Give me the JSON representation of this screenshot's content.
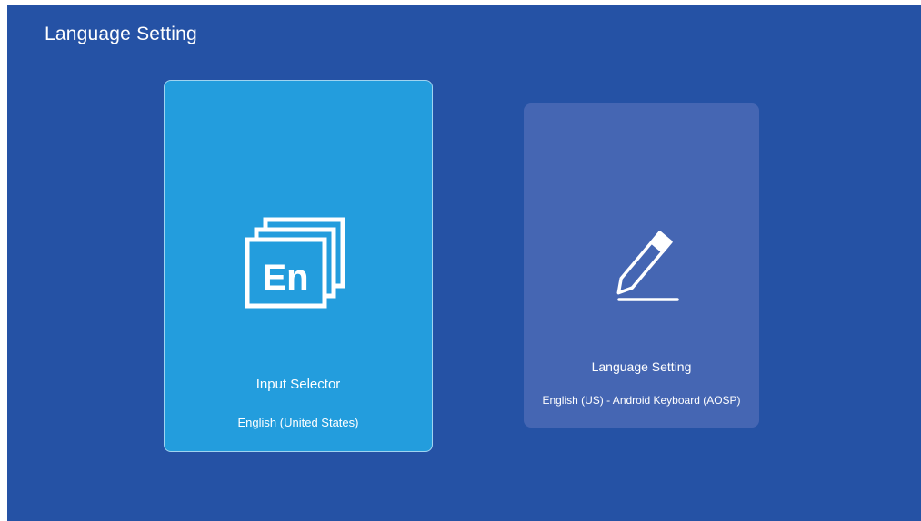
{
  "header": {
    "title": "Language Setting"
  },
  "cards": [
    {
      "title": "Input Selector",
      "subtitle": "English (United States)",
      "icon": "language-en-icon",
      "selected": true
    },
    {
      "title": "Language Setting",
      "subtitle": "English (US) - Android Keyboard (AOSP)",
      "icon": "pencil-icon",
      "selected": false
    }
  ],
  "icons": {
    "en_glyph": "En"
  },
  "colors": {
    "background": "#2552a5",
    "selected_card": "#239ddd",
    "card": "#4566b3",
    "text": "#ffffff"
  }
}
